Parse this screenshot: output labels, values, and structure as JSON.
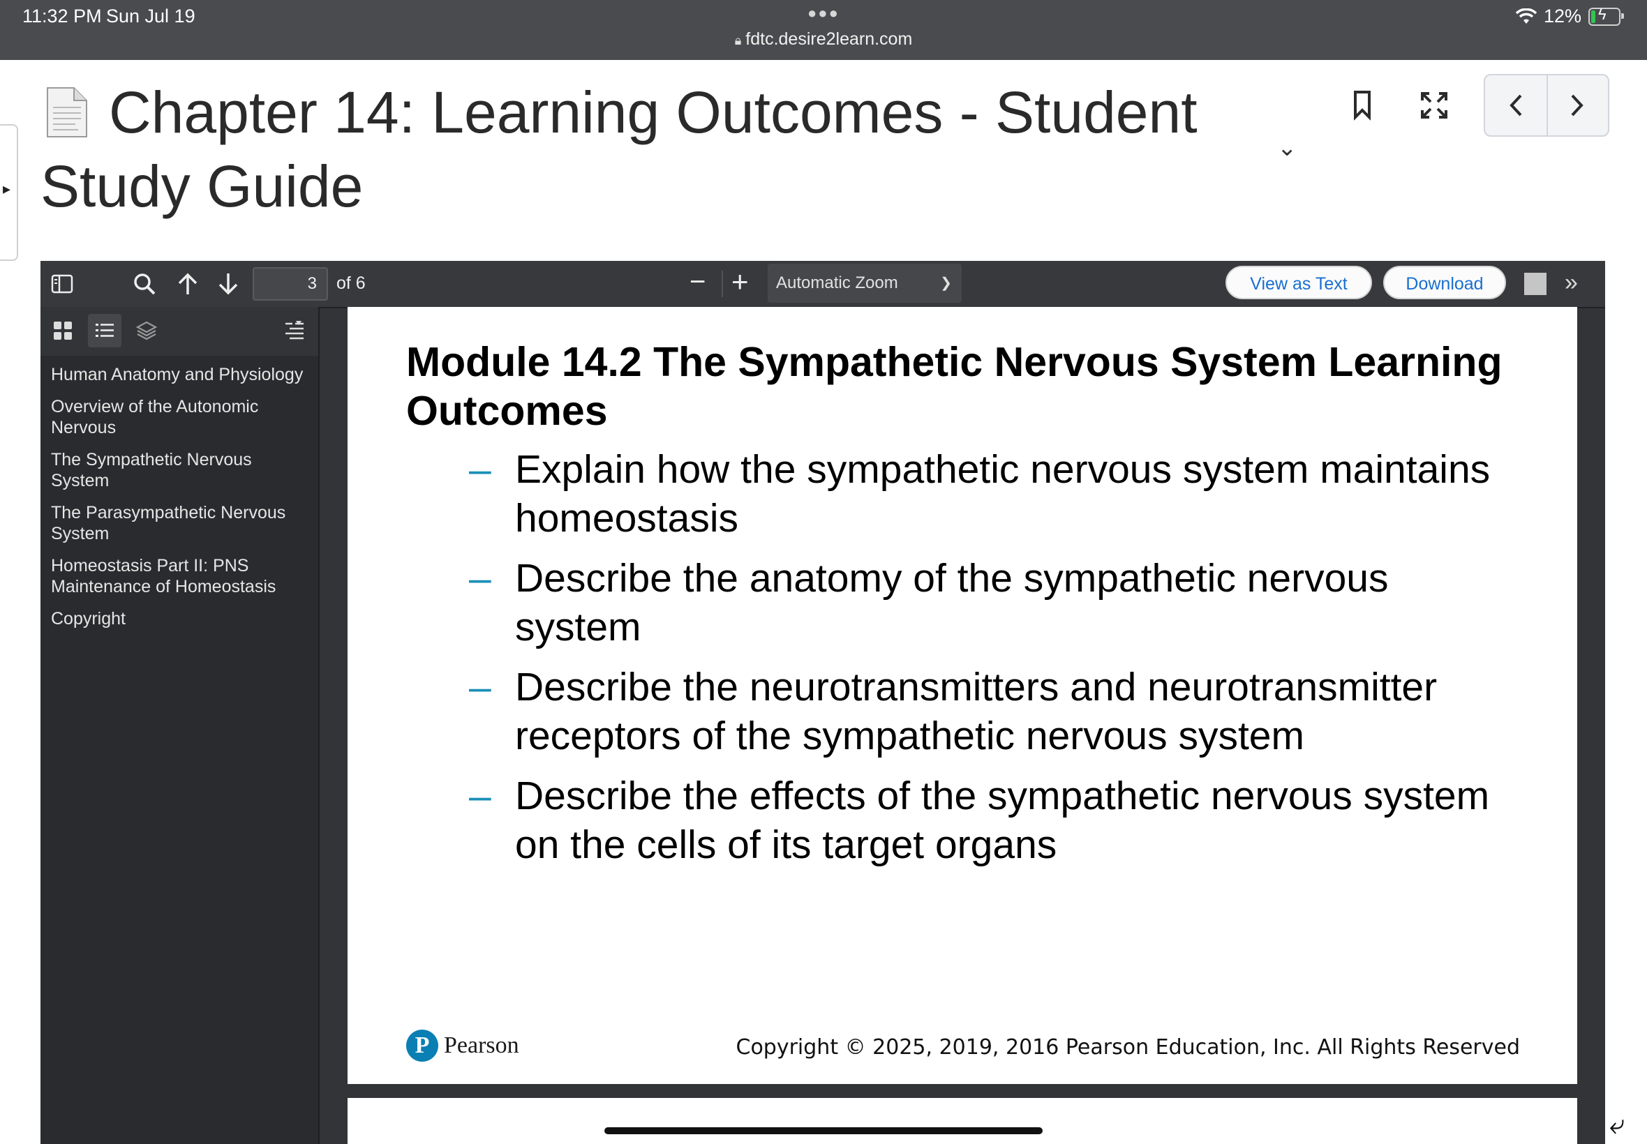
{
  "status_bar": {
    "time": "11:32 PM",
    "date": "Sun Jul 19",
    "url": "fdtc.desire2learn.com",
    "battery": "12%"
  },
  "header": {
    "title": "Chapter 14: Learning Outcomes - Student Study Guide"
  },
  "toolbar": {
    "page_number": "3",
    "page_count": "of 6",
    "zoom": "Automatic Zoom",
    "view_as_text": "View as Text",
    "download": "Download"
  },
  "sidebar": {
    "outline": [
      "Human Anatomy and Physiology",
      "Overview of the Autonomic Nervous",
      "The Sympathetic Nervous System",
      "The Parasympathetic Nervous System",
      "Homeostasis Part II: PNS Maintenance of Homeostasis",
      "Copyright"
    ]
  },
  "page": {
    "heading": "Module 14.2 The Sympathetic Nervous System Learning Outcomes",
    "outcomes": [
      "Explain how the sympathetic nervous system maintains homeostasis",
      "Describe the anatomy of the sympathetic nervous system",
      "Describe the neurotransmitters and neurotransmitter receptors of the sympathetic nervous system",
      "Describe the effects of the sympathetic nervous system on the cells of its target organs"
    ],
    "bullet": "–",
    "logo_text": "Pearson",
    "copyright": "Copyright © 2025, 2019, 2016 Pearson Education, Inc. All Rights Reserved"
  },
  "colors": {
    "status_bar": "#4a4b4e",
    "viewer_bg": "#333437",
    "bullet": "#1a8fb8",
    "link_blue": "#1a6fd0",
    "pearson_blue": "#0a7fb3"
  },
  "icons": [
    "sidebar-toggle-icon",
    "search-icon",
    "arrow-up-icon",
    "arrow-down-icon",
    "bookmark-icon",
    "fullscreen-icon",
    "chevron-left-icon",
    "chevron-right-icon",
    "thumbnails-icon",
    "outline-icon",
    "layers-icon",
    "current-outline-item-icon",
    "double-chevron-right-icon",
    "lock-icon",
    "wifi-icon",
    "battery-icon"
  ]
}
